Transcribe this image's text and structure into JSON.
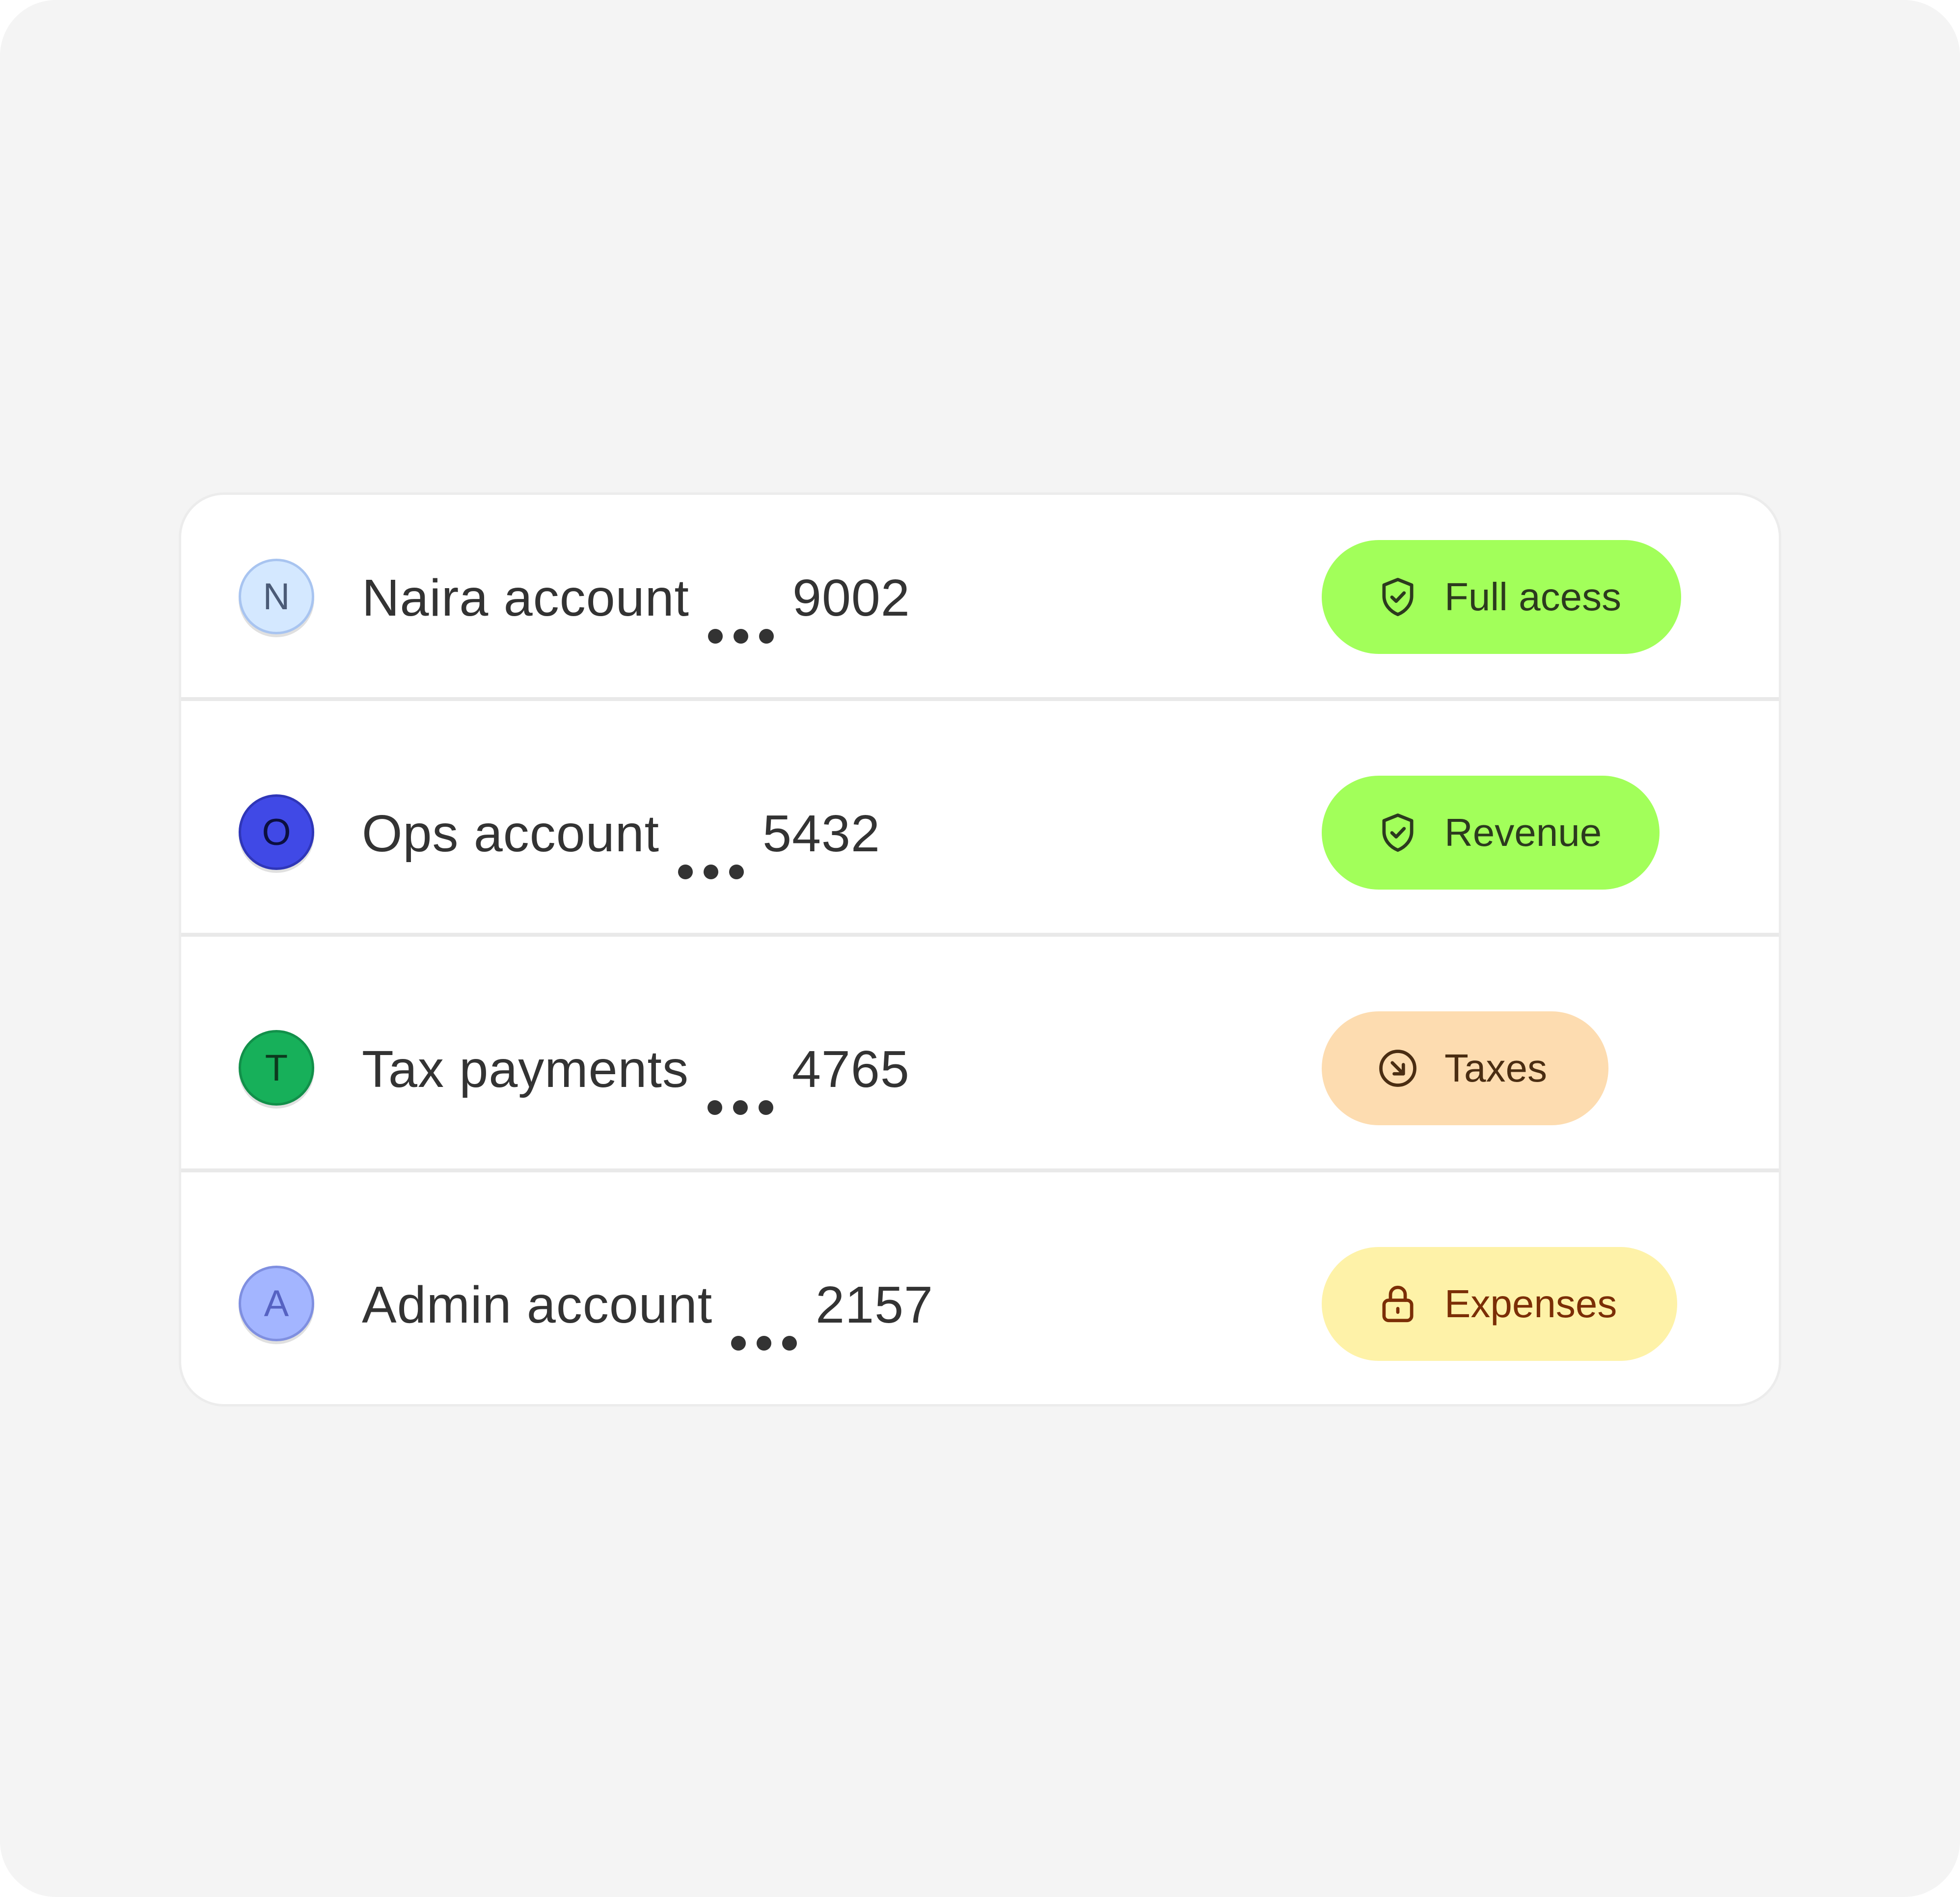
{
  "accounts": [
    {
      "avatar_letter": "N",
      "name": "Naira account",
      "number": "9002",
      "tag": {
        "label": "Full acess",
        "icon": "shield-check-icon"
      },
      "avatar_bg": "#d4e8ff",
      "avatar_border": "#a8c4f0",
      "avatar_fg": "#4b5b77",
      "tag_bg": "#a2ff5a",
      "tag_fg": "#2c3a1e"
    },
    {
      "avatar_letter": "O",
      "name": "Ops account",
      "number": "5432",
      "tag": {
        "label": "Revenue",
        "icon": "shield-check-icon"
      },
      "avatar_bg": "#4049e6",
      "avatar_border": "#2f36b8",
      "avatar_fg": "#0b0f3f",
      "tag_bg": "#a2ff5a",
      "tag_fg": "#2c3a1e"
    },
    {
      "avatar_letter": "T",
      "name": "Tax payments",
      "number": "4765",
      "tag": {
        "label": "Taxes",
        "icon": "arrow-down-right-circle-icon"
      },
      "avatar_bg": "#17b05a",
      "avatar_border": "#12904a",
      "avatar_fg": "#0c3a1e",
      "tag_bg": "#fddcb0",
      "tag_fg": "#4a2d12"
    },
    {
      "avatar_letter": "A",
      "name": "Admin account",
      "number": "2157",
      "tag": {
        "label": "Expenses",
        "icon": "lock-icon"
      },
      "avatar_bg": "#a3b5ff",
      "avatar_border": "#7f8fe0",
      "avatar_fg": "#5662c2",
      "tag_bg": "#fef2a8",
      "tag_fg": "#7b2e06"
    }
  ]
}
